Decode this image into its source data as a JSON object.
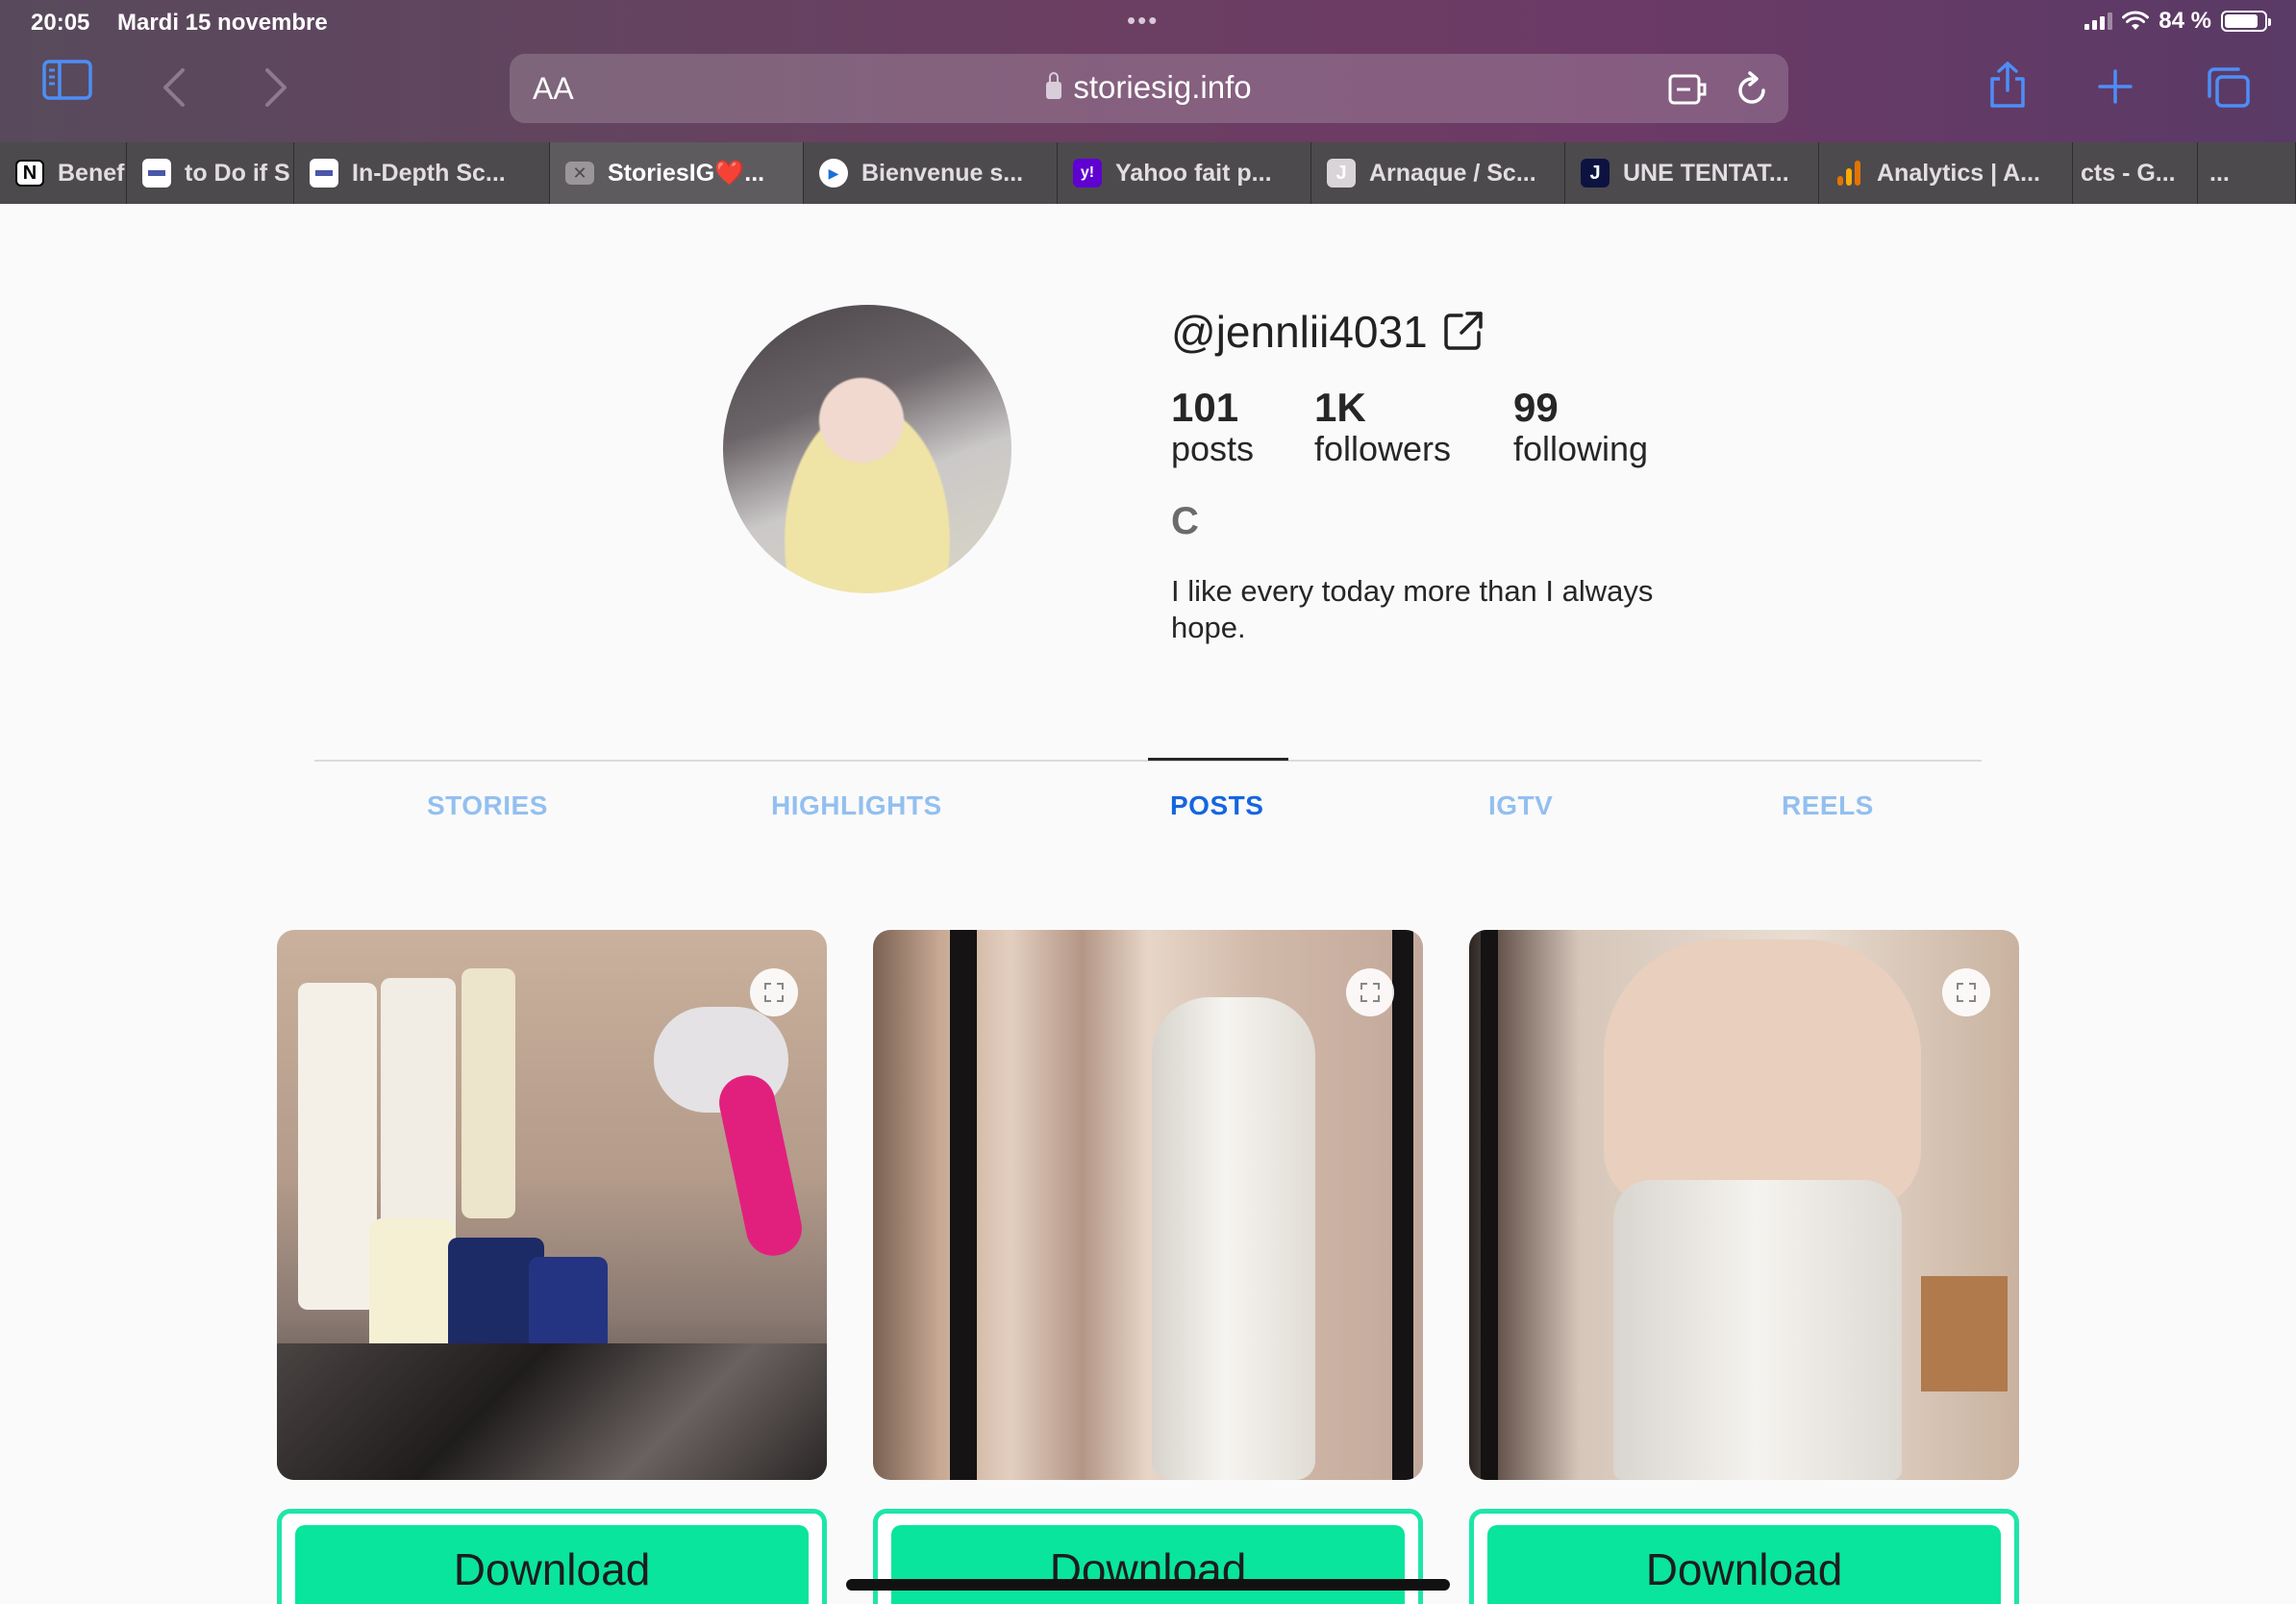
{
  "status_bar": {
    "time": "20:05",
    "date": "Mardi 15 novembre",
    "dots": "•••",
    "battery": "84 %",
    "battery_level": 0.84
  },
  "browser": {
    "text_size_label": "AA",
    "url": "storiesig.info",
    "accent_color": "#4d8ef7"
  },
  "tabs": [
    {
      "label": "Benef",
      "favicon": "N"
    },
    {
      "label": "to Do if S",
      "favicon": ""
    },
    {
      "label": "In-Depth Sc...",
      "favicon": ""
    },
    {
      "label": "StoriesIG❤️...",
      "favicon": "✕"
    },
    {
      "label": "Bienvenue s...",
      "favicon": "▶"
    },
    {
      "label": "Yahoo fait p...",
      "favicon": "y!"
    },
    {
      "label": "Arnaque / Sc...",
      "favicon": "J"
    },
    {
      "label": "UNE TENTAT...",
      "favicon": "J"
    },
    {
      "label": "Analytics | A...",
      "favicon": ""
    },
    {
      "label": "cts - G...",
      "favicon": ""
    },
    {
      "label": "...",
      "favicon": ""
    }
  ],
  "profile": {
    "username": "@jennlii4031",
    "posts_count": "101",
    "posts_label": "posts",
    "followers_count": "1K",
    "followers_label": "followers",
    "following_count": "99",
    "following_label": "following",
    "full_name": "C",
    "bio": "I like every today more than I always hope."
  },
  "profile_tabs": [
    {
      "label": "STORIES",
      "active": false
    },
    {
      "label": "HIGHLIGHTS",
      "active": false
    },
    {
      "label": "POSTS",
      "active": true
    },
    {
      "label": "IGTV",
      "active": false
    },
    {
      "label": "REELS",
      "active": false
    }
  ],
  "posts": [
    {
      "download_label": "Download"
    },
    {
      "download_label": "Download"
    },
    {
      "download_label": "Download"
    }
  ],
  "colors": {
    "download_button": "#09e59c",
    "download_border": "#1ee6a8",
    "tab_active": "#1565e0",
    "tab_inactive": "#93bff0"
  }
}
